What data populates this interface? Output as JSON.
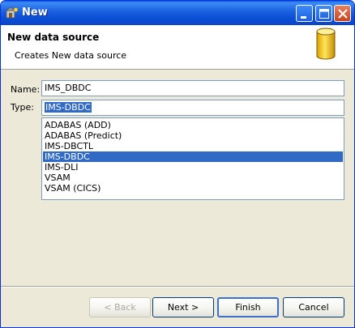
{
  "window": {
    "title": "New",
    "controls": {
      "minimize_icon": "minimize-icon",
      "maximize_icon": "maximize-icon",
      "close_icon": "close-icon"
    }
  },
  "banner": {
    "heading": "New data source",
    "description": "Creates New data source",
    "icon": "database-icon"
  },
  "form": {
    "name_label": "Name:",
    "name_value": "IMS_DBDC",
    "type_label": "Type:",
    "type_value": "IMS-DBDC",
    "type_options": [
      "ADABAS (ADD)",
      "ADABAS (Predict)",
      "IMS-DBCTL",
      "IMS-DBDC",
      "IMS-DLI",
      "VSAM",
      "VSAM (CICS)"
    ],
    "selected_option": "IMS-DBDC"
  },
  "buttons": {
    "back": "< Back",
    "next": "Next >",
    "finish": "Finish",
    "cancel": "Cancel"
  },
  "colors": {
    "titlebar": "#0a5ce0",
    "selection": "#316ac5",
    "dialog_bg": "#ece9d8"
  }
}
